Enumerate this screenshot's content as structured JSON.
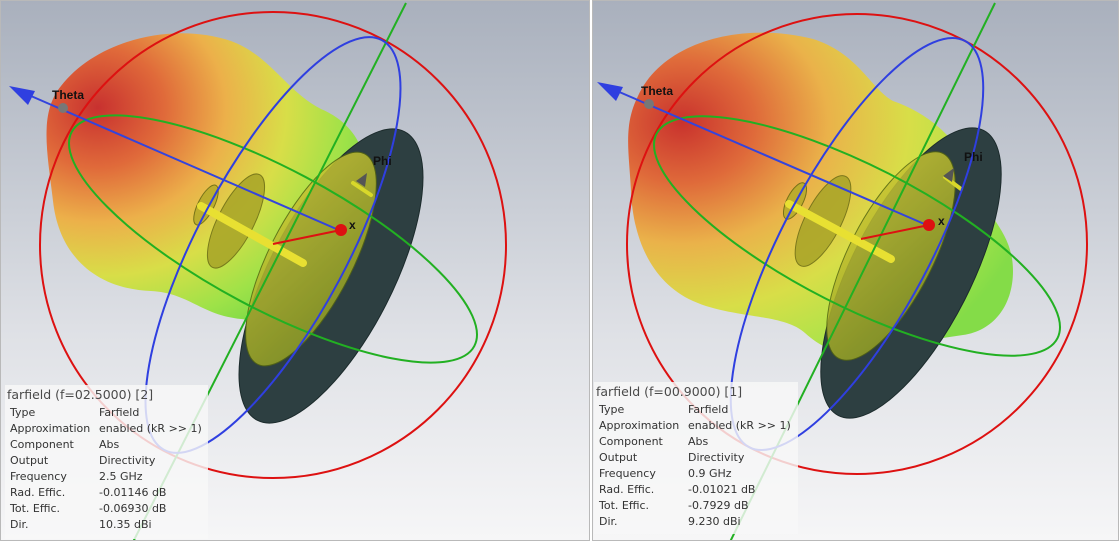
{
  "left_view": {
    "theta_label": "Theta",
    "phi_label": "Phi",
    "x_label": "x",
    "info": {
      "title": "farfield (f=02.5000) [2]",
      "rows": [
        {
          "key": "Type",
          "value": "Farfield"
        },
        {
          "key": "Approximation",
          "value": "enabled (kR >> 1)"
        },
        {
          "key": "Component",
          "value": "Abs"
        },
        {
          "key": "Output",
          "value": "Directivity"
        },
        {
          "key": "Frequency",
          "value": "2.5 GHz"
        },
        {
          "key": "Rad. Effic.",
          "value": "-0.01146 dB"
        },
        {
          "key": "Tot. Effic.",
          "value": "-0.06930 dB"
        },
        {
          "key": "Dir.",
          "value": "10.35 dBi"
        }
      ]
    }
  },
  "right_view": {
    "theta_label": "Theta",
    "phi_label": "Phi",
    "x_label": "x",
    "info": {
      "title": "farfield (f=00.9000) [1]",
      "rows": [
        {
          "key": "Type",
          "value": "Farfield"
        },
        {
          "key": "Approximation",
          "value": "enabled (kR >> 1)"
        },
        {
          "key": "Component",
          "value": "Abs"
        },
        {
          "key": "Output",
          "value": "Directivity"
        },
        {
          "key": "Frequency",
          "value": "0.9 GHz"
        },
        {
          "key": "Rad. Effic.",
          "value": "-0.01021 dB"
        },
        {
          "key": "Tot. Effic.",
          "value": "-0.7929 dB"
        },
        {
          "key": "Dir.",
          "value": "9.230 dBi"
        }
      ]
    }
  },
  "colors": {
    "sphere_circle": "#dd1111",
    "theta_axis": "#3344dd",
    "phi_ring": "#22aa22",
    "ground_plane": "#2b3d3f",
    "pattern_hot": "#d0342c",
    "pattern_mid": "#e8c84a",
    "pattern_cool": "#7ddc44"
  }
}
